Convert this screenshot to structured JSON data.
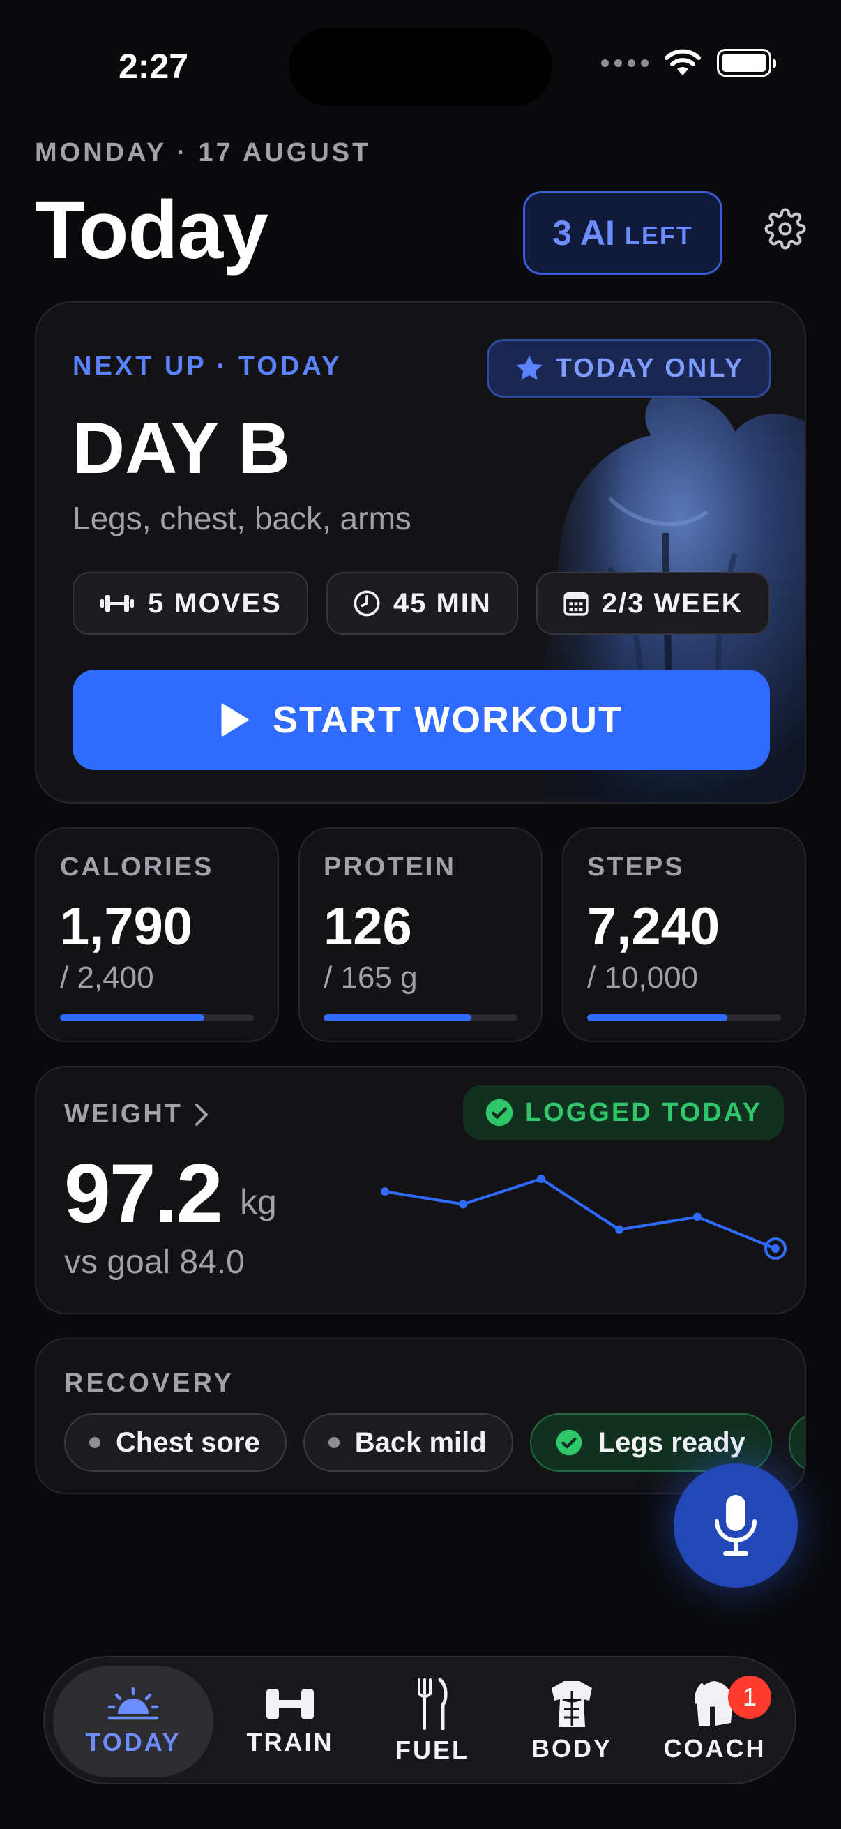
{
  "status_bar": {
    "time": "2:27"
  },
  "header": {
    "date": "MONDAY · 17 AUGUST",
    "title": "Today",
    "ai_count": "3 AI",
    "ai_left": "LEFT"
  },
  "hero": {
    "next_up": "NEXT UP · TODAY",
    "today_only": "TODAY ONLY",
    "title": "DAY B",
    "subtitle": "Legs, chest, back, arms",
    "chips": [
      {
        "icon": "dumbbell-icon",
        "label": "5 MOVES"
      },
      {
        "icon": "clock-icon",
        "label": "45 MIN"
      },
      {
        "icon": "calendar-icon",
        "label": "2/3 WEEK"
      }
    ],
    "start_label": "START WORKOUT"
  },
  "stats": [
    {
      "label": "CALORIES",
      "value": "1,790",
      "goal": "/ 2,400",
      "progress": 0.746
    },
    {
      "label": "PROTEIN",
      "value": "126",
      "goal": "/ 165 g",
      "progress": 0.764
    },
    {
      "label": "STEPS",
      "value": "7,240",
      "goal": "/ 10,000",
      "progress": 0.724
    }
  ],
  "weight": {
    "label": "WEIGHT",
    "logged": "LOGGED TODAY",
    "value": "97.2",
    "unit": "kg",
    "goal": "vs goal 84.0",
    "trend": [
      98.1,
      97.9,
      98.3,
      97.5,
      97.7,
      97.2
    ]
  },
  "recovery": {
    "label": "RECOVERY",
    "chips": [
      {
        "label": "Chest sore",
        "status": "neutral"
      },
      {
        "label": "Back mild",
        "status": "neutral"
      },
      {
        "label": "Legs ready",
        "status": "ready"
      }
    ]
  },
  "tabs": [
    {
      "label": "TODAY",
      "icon": "sunrise-icon",
      "active": true
    },
    {
      "label": "TRAIN",
      "icon": "dumbbell-icon",
      "active": false
    },
    {
      "label": "FUEL",
      "icon": "fork-knife-icon",
      "active": false
    },
    {
      "label": "BODY",
      "icon": "torso-icon",
      "active": false
    },
    {
      "label": "COACH",
      "icon": "spartan-helmet-icon",
      "active": false,
      "badge": "1"
    }
  ],
  "colors": {
    "accent": "#2f6bff",
    "accent_text": "#6d8cff",
    "success": "#30c76a",
    "badge": "#ff3b30",
    "background": "#0a0a0c",
    "card": "#131316"
  }
}
